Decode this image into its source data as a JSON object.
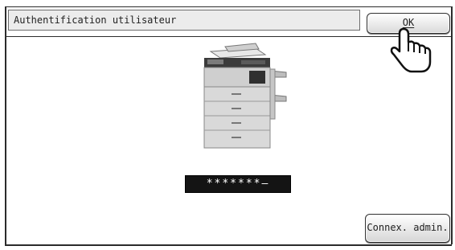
{
  "dialog": {
    "title": "Authentification utilisateur",
    "ok_label": "OK",
    "password_mask": "*******—",
    "admin_login_label": "Connex. admin."
  },
  "icons": {
    "pointer": "pointing-hand-icon",
    "device": "printer-icon"
  },
  "colors": {
    "frame": "#2b2b2b",
    "title_field_bg": "#ececec",
    "password_bg": "#141414"
  }
}
